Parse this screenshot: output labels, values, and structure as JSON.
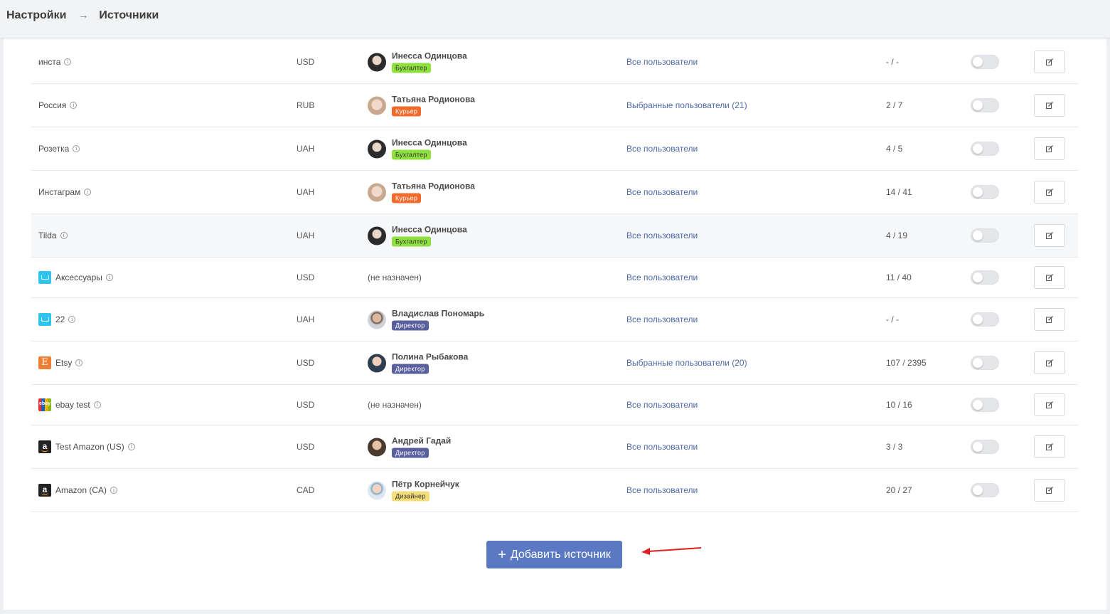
{
  "header": {
    "crumb_settings": "Настройки",
    "crumb_arrow": "→",
    "crumb_sources": "Источники"
  },
  "rows": [
    {
      "name": "инста",
      "icon": "",
      "currency": "USD",
      "person": "Инесса Одинцова",
      "role": "Бухгалтер",
      "role_color": "#8ee03f",
      "avatar": "dark",
      "users": "Все пользователи",
      "count": "- / -",
      "highlight": false
    },
    {
      "name": "Россия",
      "icon": "",
      "currency": "RUB",
      "person": "Татьяна Родионова",
      "role": "Курьер",
      "role_color": "#f06a2c",
      "avatar": "blond",
      "users": "Выбранные пользователи (21)",
      "count": "2 / 7",
      "highlight": false
    },
    {
      "name": "Розетка",
      "icon": "",
      "currency": "UAH",
      "person": "Инесса Одинцова",
      "role": "Бухгалтер",
      "role_color": "#8ee03f",
      "avatar": "dark",
      "users": "Все пользователи",
      "count": "4 / 5",
      "highlight": false
    },
    {
      "name": "Инстаграм",
      "icon": "",
      "currency": "UAH",
      "person": "Татьяна Родионова",
      "role": "Курьер",
      "role_color": "#f06a2c",
      "avatar": "blond",
      "users": "Все пользователи",
      "count": "14 / 41",
      "highlight": false
    },
    {
      "name": "Tilda",
      "icon": "",
      "currency": "UAH",
      "person": "Инесса Одинцова",
      "role": "Бухгалтер",
      "role_color": "#8ee03f",
      "avatar": "dark",
      "users": "Все пользователи",
      "count": "4 / 19",
      "highlight": true
    },
    {
      "name": "Аксессуары",
      "icon": "cart-icon",
      "currency": "USD",
      "person": "",
      "role": "",
      "unassigned": "(не назначен)",
      "users": "Все пользователи",
      "count": "11 / 40",
      "highlight": false
    },
    {
      "name": "22",
      "icon": "cart-icon",
      "currency": "UAH",
      "person": "Владислав Пономарь",
      "role": "Директор",
      "role_color": "#5a5f9e",
      "avatar": "beard",
      "users": "Все пользователи",
      "count": "- / -",
      "highlight": false
    },
    {
      "name": "Etsy",
      "icon": "etsy-icon",
      "icon_text": "E",
      "currency": "USD",
      "person": "Полина Рыбакова",
      "role": "Директор",
      "role_color": "#5a5f9e",
      "avatar": "man",
      "users": "Выбранные пользователи (20)",
      "count": "107 / 2395",
      "highlight": false
    },
    {
      "name": "ebay test",
      "icon": "ebay-icon",
      "icon_text": "ebay",
      "currency": "USD",
      "person": "",
      "role": "",
      "unassigned": "(не назначен)",
      "users": "Все пользователи",
      "count": "10 / 16",
      "highlight": false
    },
    {
      "name": "Test Amazon (US)",
      "icon": "amazon-icon",
      "icon_text": "a",
      "currency": "USD",
      "person": "Андрей Гадай",
      "role": "Директор",
      "role_color": "#5a5f9e",
      "avatar": "ginger",
      "users": "Все пользователи",
      "count": "3 / 3",
      "highlight": false
    },
    {
      "name": "Amazon (CA)",
      "icon": "amazon-icon",
      "icon_text": "a",
      "currency": "CAD",
      "person": "Пётр Корнейчук",
      "role": "Дизайнер",
      "role_color": "#f3dc7a",
      "avatar": "light",
      "users": "Все пользователи",
      "count": "20 / 27",
      "highlight": false
    }
  ],
  "add_button": {
    "plus": "+",
    "label": "Добавить источник"
  },
  "colors": {
    "accent": "#5b78c2",
    "link": "#4e68a8",
    "arrow": "#e02020"
  }
}
